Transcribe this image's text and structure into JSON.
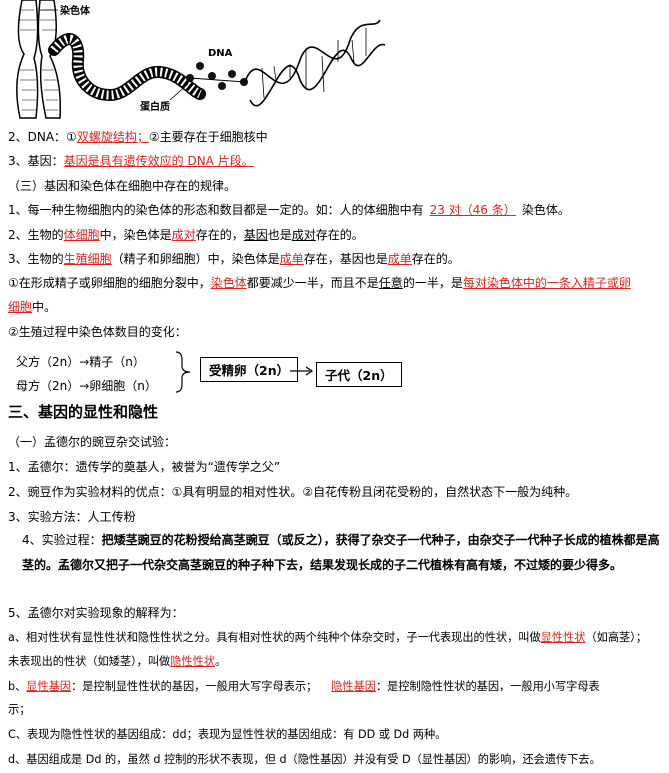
{
  "figure": {
    "label_chromosome": "染色体",
    "label_dna": "DNA",
    "label_protein": "蛋白质"
  },
  "lines": {
    "l2_prefix": "2、DNA：①",
    "l2_red": "双螺旋结构；",
    "l2_suffix": "②主要存在于细胞核中",
    "l3_prefix": "3、基因：",
    "l3_red": "基因是具有遗传效应的 DNA 片段。",
    "s3_title": "（三）基因和染色体在细胞中存在的规律。",
    "r1_prefix": "1、每一种生物细胞内的染色体的形态和数目都是一定的。如：人的体细胞中有",
    "r1_red": "23 对（46 条）",
    "r1_suffix": "染色体。",
    "r2_a": "2、生物的",
    "r2_b": "体细胞",
    "r2_c": "中，染色体是",
    "r2_d": "成对",
    "r2_e": "存在的，",
    "r2_f": "基因",
    "r2_g": "也是",
    "r2_h": "成对",
    "r2_i": "存在的。",
    "r3_a": "3、生物的",
    "r3_b": "生殖细胞",
    "r3_c": "（精子和卵细胞）中，染色体是",
    "r3_d": "成单",
    "r3_e": "存在，基因也是",
    "r3_f": "成单",
    "r3_g": "存在的。",
    "c1_a": "①在形成精子或卵细胞的细胞分裂中，",
    "c1_b": "染色体",
    "c1_c": "都要减少一半，而且不是",
    "c1_d": "任意",
    "c1_e": "的一半，是",
    "c1_f": "每对染色体中的一条入精子或卵",
    "c1_g": "细胞",
    "c1_h": "中。",
    "c2": "②生殖过程中染色体数目的变化：",
    "flow_father": "父方（2n）→精子（n）",
    "flow_mother": "母方（2n）→卵细胞（n）",
    "flow_box1": "受精卵（2n）",
    "flow_box2": "子代（2n）",
    "h3": "三、基因的显性和隐性",
    "m_title": "（一）孟德尔的豌豆杂交试验：",
    "m1": "1、孟德尔：遗传学的奠基人，被誉为“遗传学之父”",
    "m2": "2、豌豆作为实验材料的优点：①具有明显的相对性状。②自花传粉且闭花受粉的，自然状态下一般为纯种。",
    "m3": "3、实验方法：人工传粉",
    "m4_label": "4、实验过程：",
    "m4_text": "把矮茎豌豆的花粉授给高茎豌豆（或反之），获得了杂交子一代种子，由杂交子一代种子长成的植株都是高茎的。孟德尔又把子一代杂交高茎豌豆的种子种下去，结果发现长成的子二代植株有高有矮，不过矮的要少得多。",
    "m5": "5、孟德尔对实验现象的解释为：",
    "a_1": "a、相对性状有显性性状和隐性性状之分。具有相对性状的两个纯种个体杂交时，子一代表现出的性状，叫做",
    "a_2": "显性性状",
    "a_3": "（如高茎）；",
    "a_4": "未表现出的性状（如矮茎），叫做",
    "a_5": "隐性性状",
    "a_6": "。",
    "b_1": "b、",
    "b_2": "显性基因",
    "b_3": "：是控制显性性状的基因，一般用大写字母表示；",
    "b_4": "隐性基因",
    "b_5": "：是控制隐性性状的基因，一般用小写字母表",
    "b_6": "示；",
    "c_line": "C、表现为隐性性状的基因组成：dd；表现为显性性状的基因组成：有 DD 或 Dd 两种。",
    "d_line": "d、基因组成是 Dd 的，虽然 d 控制的形状不表现，但 d（隐性基因）并没有受 D（显性基因）的影响，还会遗传下去。"
  }
}
